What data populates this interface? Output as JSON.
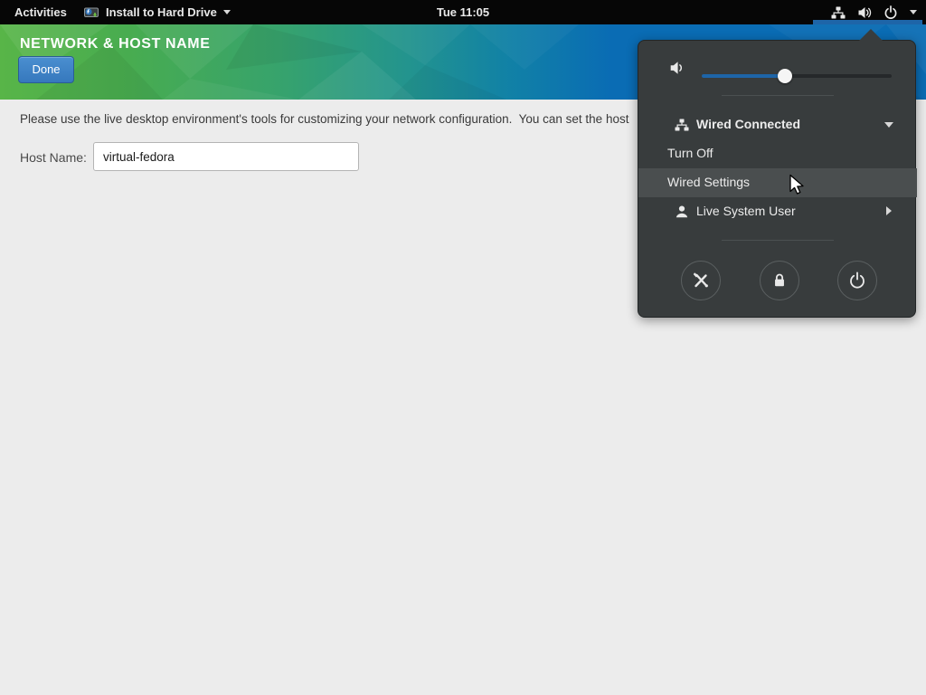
{
  "top_bar": {
    "activities_label": "Activities",
    "app_menu_label": "Install to Hard Drive",
    "clock": "Tue 11:05"
  },
  "header": {
    "title": "NETWORK & HOST NAME",
    "done_button": "Done"
  },
  "content": {
    "instruction": "Please use the live desktop environment's tools for customizing your network configuration.  You can set the host",
    "host_name_label": "Host Name:",
    "host_name_value": "virtual-fedora"
  },
  "system_menu": {
    "volume_percent": 44,
    "items": {
      "wired": {
        "label": "Wired Connected",
        "state": "expanded"
      },
      "turn_off": {
        "label": "Turn Off"
      },
      "wired_settings": {
        "label": "Wired Settings",
        "highlighted": true
      },
      "user": {
        "label": "Live System User",
        "state": "collapsed"
      }
    },
    "action_buttons": [
      "settings",
      "lock",
      "power"
    ]
  },
  "colors": {
    "topbar_bg": "#060606",
    "header_gradient_start": "#58b548",
    "header_gradient_end": "#0a6cb4",
    "accent_blue": "#1e65a8",
    "popup_bg": "#383c3d",
    "popup_highlight_row": "#4a4e4f",
    "content_bg": "#ececec",
    "done_button_bg": "#3e83c8"
  }
}
